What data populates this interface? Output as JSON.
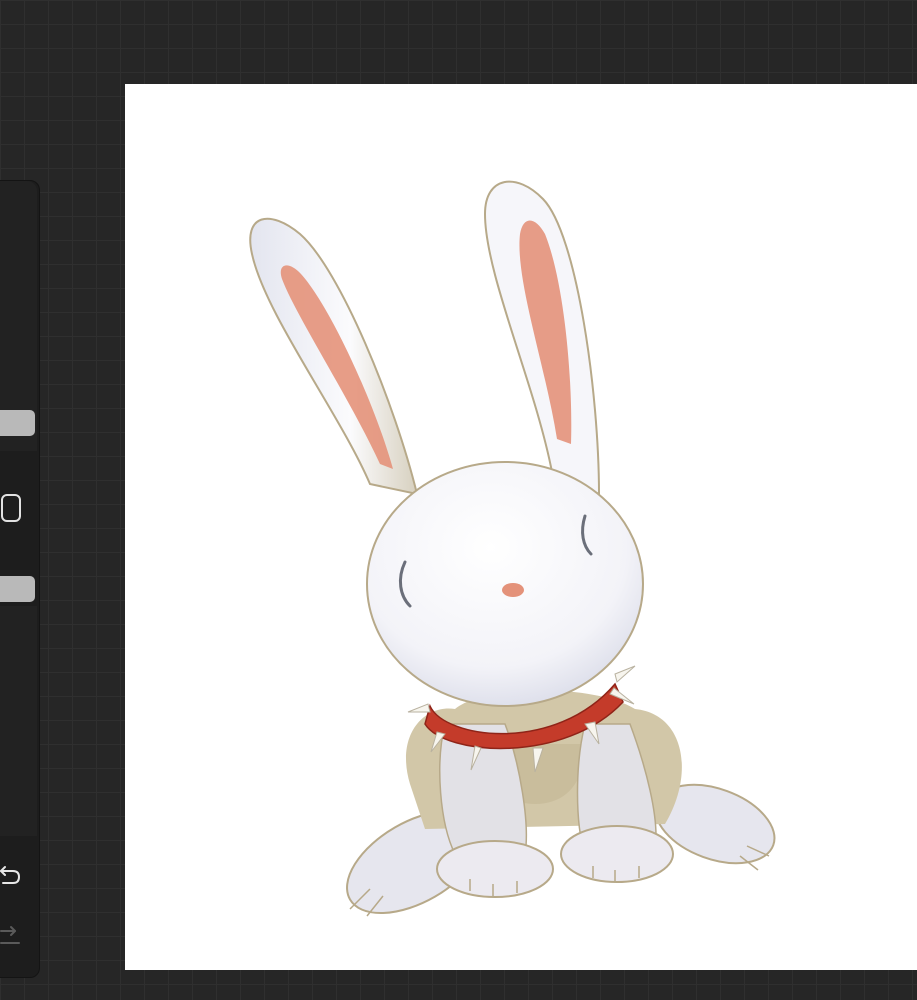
{
  "toolbar": {
    "tools": [
      {
        "id": "brush-size-slider",
        "icon": "slider-knob"
      },
      {
        "id": "modify-button",
        "icon": "square-outline-icon"
      },
      {
        "id": "opacity-slider",
        "icon": "slider-knob"
      },
      {
        "id": "undo-button",
        "icon": "undo-arrow-icon"
      },
      {
        "id": "redo-button",
        "icon": "redo-arrow-icon"
      }
    ],
    "redo_enabled": false
  },
  "canvas": {
    "background": "#ffffff",
    "artwork": "white-rabbit-with-red-spiked-collar"
  },
  "colors": {
    "app_background": "#262626",
    "sidebar": "#1d1d1d",
    "slider_knob": "#b9b9b9",
    "collar_red": "#c43b2a",
    "ear_inner": "#e4927a"
  }
}
